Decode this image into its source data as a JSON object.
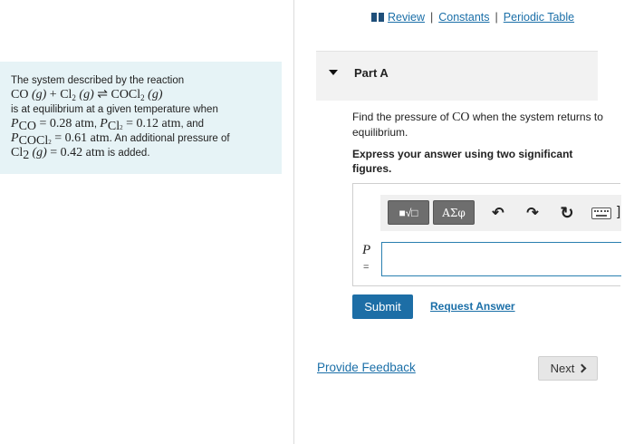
{
  "links": {
    "review": "Review",
    "constants": "Constants",
    "periodic_table": "Periodic Table",
    "separator": "|"
  },
  "problem": {
    "intro": "The system described by the reaction",
    "reaction": {
      "lhs1": "CO",
      "phase1": "(g)",
      "plus": "+",
      "lhs2": "Cl",
      "lhs2_sub": "2",
      "phase2": "(g)",
      "arrow": "⇌",
      "rhs": "COCl",
      "rhs_sub": "2",
      "phase3": "(g)"
    },
    "line2": "is at equilibrium at a given temperature when",
    "p_co_label": "P",
    "p_co_sub": "CO",
    "p_co_val": " = 0.28 atm",
    "p_cl2_label": "P",
    "p_cl2_sub": "Cl",
    "p_cl2_sub2": "2",
    "p_cl2_val": " = 0.12 atm",
    "and": ", and",
    "p_cocl2_label": "P",
    "p_cocl2_sub": "COCl",
    "p_cocl2_sub2": "2",
    "p_cocl2_val": " = 0.61 atm",
    "additional": ". An additional pressure of",
    "cl2": "Cl",
    "cl2_sub": "2",
    "cl2_phase": "(g)",
    "cl2_val": " = 0.42 atm",
    "added": " is added."
  },
  "part": {
    "title": "Part A"
  },
  "question": {
    "pre": "Find the pressure of ",
    "species": "CO",
    "post": " when the system returns to equilibrium."
  },
  "instruction": "Express your answer using two significant figures.",
  "toolbar": {
    "templates_symbol": "■√□",
    "greek_symbol": "ΑΣφ",
    "undo_symbol": "↶",
    "redo_symbol": "↷",
    "reset_symbol": "↻",
    "bracket": "]"
  },
  "answer": {
    "variable": "P",
    "equals": "=",
    "value": ""
  },
  "buttons": {
    "submit": "Submit",
    "request_answer": "Request Answer",
    "provide_feedback": "Provide Feedback",
    "next": "Next"
  }
}
